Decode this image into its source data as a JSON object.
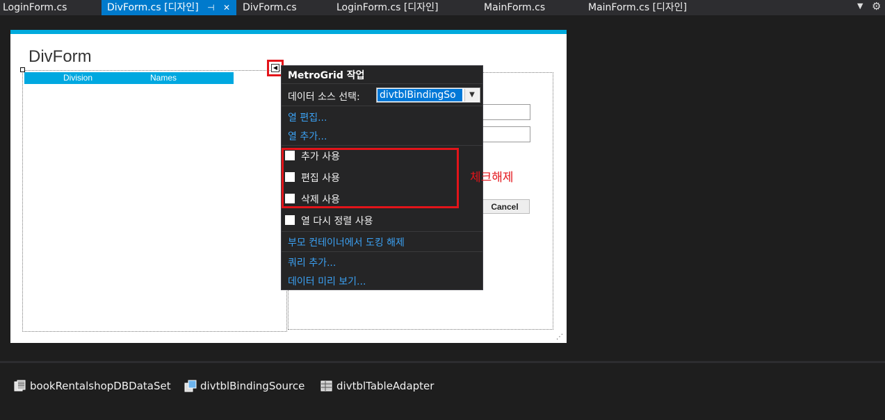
{
  "tabs": [
    {
      "label": "LoginForm.cs",
      "active": false
    },
    {
      "label": "DivForm.cs [디자인]",
      "active": true
    },
    {
      "label": "DivForm.cs",
      "active": false
    },
    {
      "label": "LoginForm.cs [디자인]",
      "active": false
    },
    {
      "label": "MainForm.cs",
      "active": false
    },
    {
      "label": "MainForm.cs [디자인]",
      "active": false
    }
  ],
  "tab_icons": {
    "pin": "⊣",
    "close": "✕",
    "dropdown": "▼",
    "gear": "⚙"
  },
  "form": {
    "title": "DivForm",
    "grid_columns": [
      "Division",
      "Names"
    ],
    "cancel_label": "Cancel",
    "accent_color": "#00aadd"
  },
  "smart_tag": {
    "title": "MetroGrid 작업",
    "datasource_label": "데이터 소스 선택:",
    "datasource_value": "divtblBindingSo",
    "links_top": [
      "열 편집...",
      "열 추가..."
    ],
    "checkboxes": [
      {
        "label": "추가 사용",
        "checked": false
      },
      {
        "label": "편집 사용",
        "checked": false
      },
      {
        "label": "삭제 사용",
        "checked": false
      },
      {
        "label": "열 다시 정렬 사용",
        "checked": false
      }
    ],
    "links_bottom": [
      "부모 컨테이너에서 도킹 해제",
      "쿼리 추가...",
      "데이터 미리 보기..."
    ]
  },
  "annotation": {
    "text": "체크해제",
    "color": "#e3141a"
  },
  "tray": [
    {
      "label": "bookRentalshopDBDataSet",
      "icon": "dataset-icon"
    },
    {
      "label": "divtblBindingSource",
      "icon": "binding-source-icon"
    },
    {
      "label": "divtblTableAdapter",
      "icon": "table-adapter-icon"
    }
  ]
}
